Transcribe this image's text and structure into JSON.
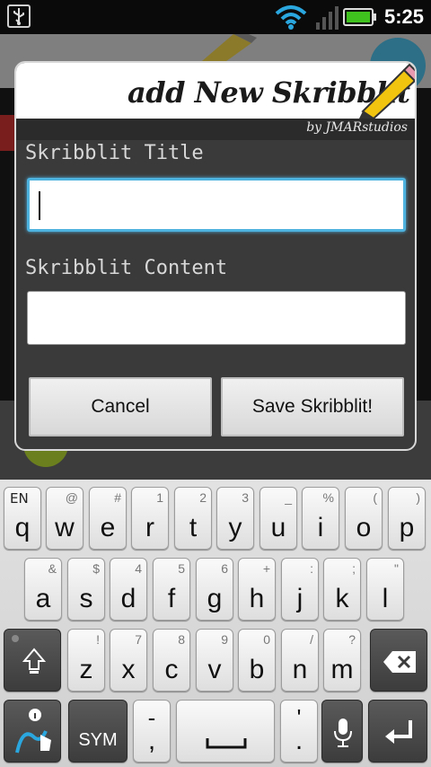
{
  "status_bar": {
    "time": "5:25",
    "icons": [
      "usb-icon",
      "wifi-icon",
      "signal-icon",
      "battery-icon"
    ],
    "battery_color": "#3fc21e"
  },
  "dialog": {
    "title": "add New Skribblit",
    "byline": "by JMARstudios",
    "title_label": "Skribblit Title",
    "title_value": "",
    "content_label": "Skribblit Content",
    "content_value": "",
    "cancel_label": "Cancel",
    "save_label": "Save Skribblit!",
    "accent": "#4fb3e0"
  },
  "keyboard": {
    "language": "EN",
    "row1": [
      {
        "main": "q",
        "alt": ""
      },
      {
        "main": "w",
        "alt": "@"
      },
      {
        "main": "e",
        "alt": "#"
      },
      {
        "main": "r",
        "alt": "1"
      },
      {
        "main": "t",
        "alt": "2"
      },
      {
        "main": "y",
        "alt": "3"
      },
      {
        "main": "u",
        "alt": "_"
      },
      {
        "main": "i",
        "alt": "%"
      },
      {
        "main": "o",
        "alt": "("
      },
      {
        "main": "p",
        "alt": ")"
      }
    ],
    "row2": [
      {
        "main": "a",
        "alt": "&"
      },
      {
        "main": "s",
        "alt": "$"
      },
      {
        "main": "d",
        "alt": "4"
      },
      {
        "main": "f",
        "alt": "5"
      },
      {
        "main": "g",
        "alt": "6"
      },
      {
        "main": "h",
        "alt": "+"
      },
      {
        "main": "j",
        "alt": ":"
      },
      {
        "main": "k",
        "alt": ";"
      },
      {
        "main": "l",
        "alt": "\""
      }
    ],
    "row3": [
      {
        "main": "z",
        "alt": "!"
      },
      {
        "main": "x",
        "alt": "7"
      },
      {
        "main": "c",
        "alt": "8"
      },
      {
        "main": "v",
        "alt": "9"
      },
      {
        "main": "b",
        "alt": "0"
      },
      {
        "main": "n",
        "alt": "/"
      },
      {
        "main": "m",
        "alt": "?"
      }
    ],
    "sym_label": "SYM",
    "dash_comma": {
      "main": ",",
      "alt": "-"
    },
    "apos_period": {
      "main": ".",
      "alt": "'"
    }
  }
}
